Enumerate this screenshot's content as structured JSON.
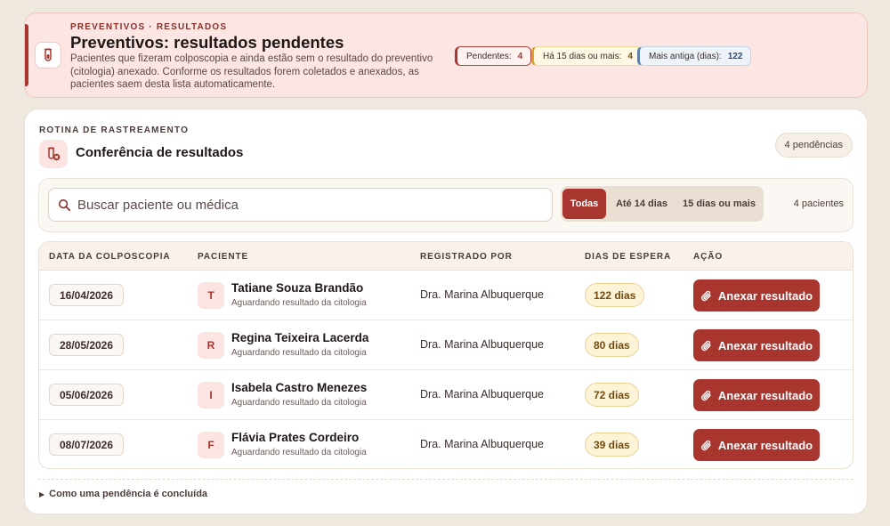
{
  "banner": {
    "kicker": "PREVENTIVOS · RESULTADOS",
    "title": "Preventivos: resultados pendentes",
    "description": "Pacientes que fizeram colposcopia e ainda estão sem o resultado do preventivo (citologia) anexado. Conforme os resultados forem coletados e anexados, as pacientes saem desta lista automaticamente.",
    "icon": "test-tube-icon",
    "stats": [
      {
        "label": "Pendentes:",
        "value": "4",
        "color": "#a8362f"
      },
      {
        "label": "Há 15 dias ou mais:",
        "value": "4",
        "color": "#d6a42a"
      },
      {
        "label": "Mais antiga (dias):",
        "value": "122",
        "color": "#5d7fa8"
      }
    ]
  },
  "card": {
    "eyebrow": "ROTINA DE RASTREAMENTO",
    "title": "Conferência de resultados",
    "icon": "test-tube-alert-icon",
    "count_badge": "4 pendências"
  },
  "filters": {
    "search_placeholder": "Buscar paciente ou médica",
    "search_value": "",
    "options": [
      {
        "label": "Todas",
        "active": true
      },
      {
        "label": "Até 14 dias",
        "active": false
      },
      {
        "label": "15 dias ou mais",
        "active": false
      }
    ],
    "result_count": "4 pacientes"
  },
  "table": {
    "columns": [
      "DATA DA COLPOSCOPIA",
      "PACIENTE",
      "REGISTRADO POR",
      "DIAS DE ESPERA",
      "AÇÃO"
    ],
    "rows": [
      {
        "date": "16/04/2026",
        "initial": "T",
        "name": "Tatiane Souza Brandão",
        "status": "Aguardando resultado da citologia",
        "registered_by": "Dra. Marina Albuquerque",
        "wait": "122 dias",
        "action": "Anexar resultado"
      },
      {
        "date": "28/05/2026",
        "initial": "R",
        "name": "Regina Teixeira Lacerda",
        "status": "Aguardando resultado da citologia",
        "registered_by": "Dra. Marina Albuquerque",
        "wait": "80 dias",
        "action": "Anexar resultado"
      },
      {
        "date": "05/06/2026",
        "initial": "I",
        "name": "Isabela Castro Menezes",
        "status": "Aguardando resultado da citologia",
        "registered_by": "Dra. Marina Albuquerque",
        "wait": "72 dias",
        "action": "Anexar resultado"
      },
      {
        "date": "08/07/2026",
        "initial": "F",
        "name": "Flávia Prates Cordeiro",
        "status": "Aguardando resultado da citologia",
        "registered_by": "Dra. Marina Albuquerque",
        "wait": "39 dias",
        "action": "Anexar resultado"
      }
    ]
  },
  "footer": {
    "disclosure_label": "Como uma pendência é concluída"
  },
  "colors": {
    "accent": "#a8362f",
    "warning": "#d6a42a",
    "info": "#5d7fa8",
    "background": "#efe8df"
  }
}
